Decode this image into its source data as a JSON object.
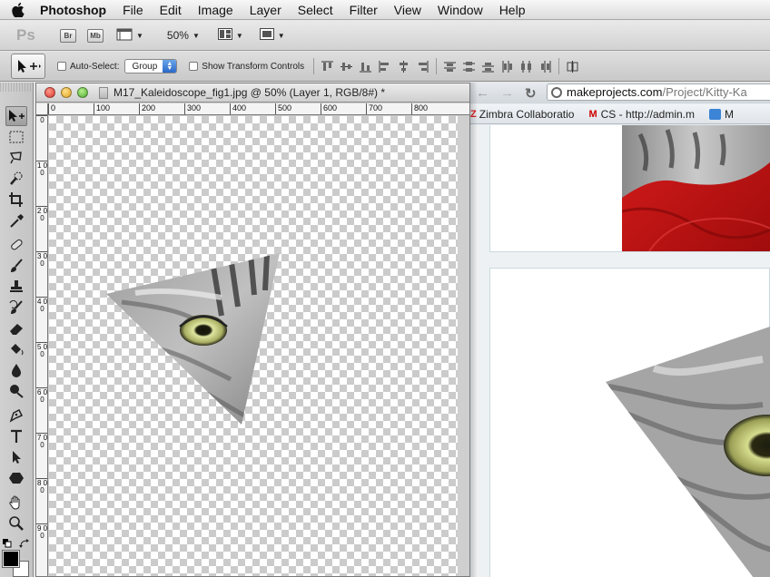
{
  "menubar": {
    "app_name": "Photoshop",
    "items": [
      "File",
      "Edit",
      "Image",
      "Layer",
      "Select",
      "Filter",
      "View",
      "Window",
      "Help"
    ]
  },
  "appbar": {
    "logo": "Ps",
    "bridge_label": "Br",
    "minibridge_label": "Mb",
    "zoom": "50%"
  },
  "options": {
    "auto_select_label": "Auto-Select:",
    "auto_select_value": "Group",
    "show_transform_label": "Show Transform Controls"
  },
  "document": {
    "title": "M17_Kaleidoscope_fig1.jpg @ 50% (Layer 1, RGB/8#) *",
    "ruler_top": [
      "0",
      "100",
      "200",
      "300",
      "400",
      "500",
      "600",
      "700",
      "800"
    ],
    "ruler_left": [
      "0",
      "1 0 0",
      "2 0 0",
      "3 0 0",
      "4 0 0",
      "5 0 0",
      "6 0 0",
      "7 0 0",
      "8 0 0",
      "9 0 0"
    ]
  },
  "browser": {
    "url_host": "makeprojects.com",
    "url_path": "/Project/Kitty-Ka",
    "bookmarks": [
      "Zimbra Collaboratio",
      "CS - http://admin.m",
      "M"
    ]
  },
  "colors": {
    "foreground": "#000000",
    "background": "#ffffff"
  }
}
